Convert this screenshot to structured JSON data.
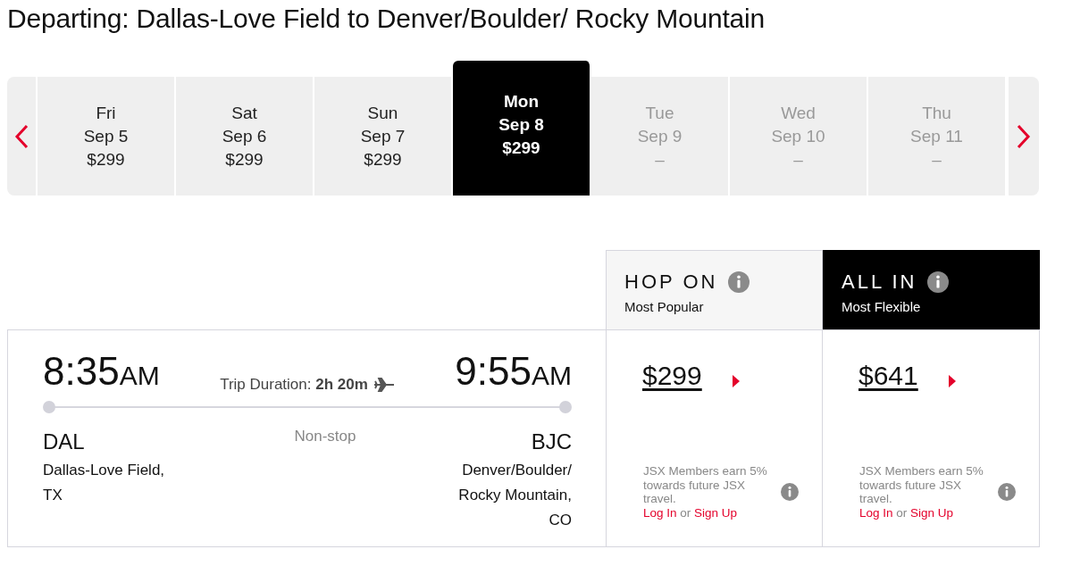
{
  "heading": "Departing: Dallas-Love Field to Denver/Boulder/ Rocky Mountain",
  "dates": [
    {
      "day": "Fri",
      "date": "Sep 5",
      "price": "$299",
      "selected": false,
      "available": true
    },
    {
      "day": "Sat",
      "date": "Sep 6",
      "price": "$299",
      "selected": false,
      "available": true
    },
    {
      "day": "Sun",
      "date": "Sep 7",
      "price": "$299",
      "selected": false,
      "available": true
    },
    {
      "day": "Mon",
      "date": "Sep 8",
      "price": "$299",
      "selected": true,
      "available": true
    },
    {
      "day": "Tue",
      "date": "Sep 9",
      "price": "–",
      "selected": false,
      "available": false
    },
    {
      "day": "Wed",
      "date": "Sep 10",
      "price": "–",
      "selected": false,
      "available": false
    },
    {
      "day": "Thu",
      "date": "Sep 11",
      "price": "–",
      "selected": false,
      "available": false
    }
  ],
  "fares": [
    {
      "name": "HOP ON",
      "subtitle": "Most Popular",
      "kind": "standard",
      "price": "$299",
      "note": "JSX Members earn 5% towards future JSX travel.",
      "login": "Log In",
      "or": "or",
      "signup": "Sign Up"
    },
    {
      "name": "ALL IN",
      "subtitle": "Most Flexible",
      "kind": "featured",
      "price": "$641",
      "note": "JSX Members earn 5% towards future JSX travel.",
      "login": "Log In",
      "or": "or",
      "signup": "Sign Up"
    }
  ],
  "flight": {
    "depart_time": "8:35",
    "depart_period": "AM",
    "duration": "Trip Duration: **2h 20m**",
    "arrive_time": "9:55",
    "arrive_period": "AM",
    "stops": "Non-stop",
    "origin_code": "DAL",
    "origin_name": "Dallas-Love Field, TX",
    "destination_code": "BJC",
    "destination_name": "Denver/Boulder/ Rocky Mountain, CO"
  }
}
